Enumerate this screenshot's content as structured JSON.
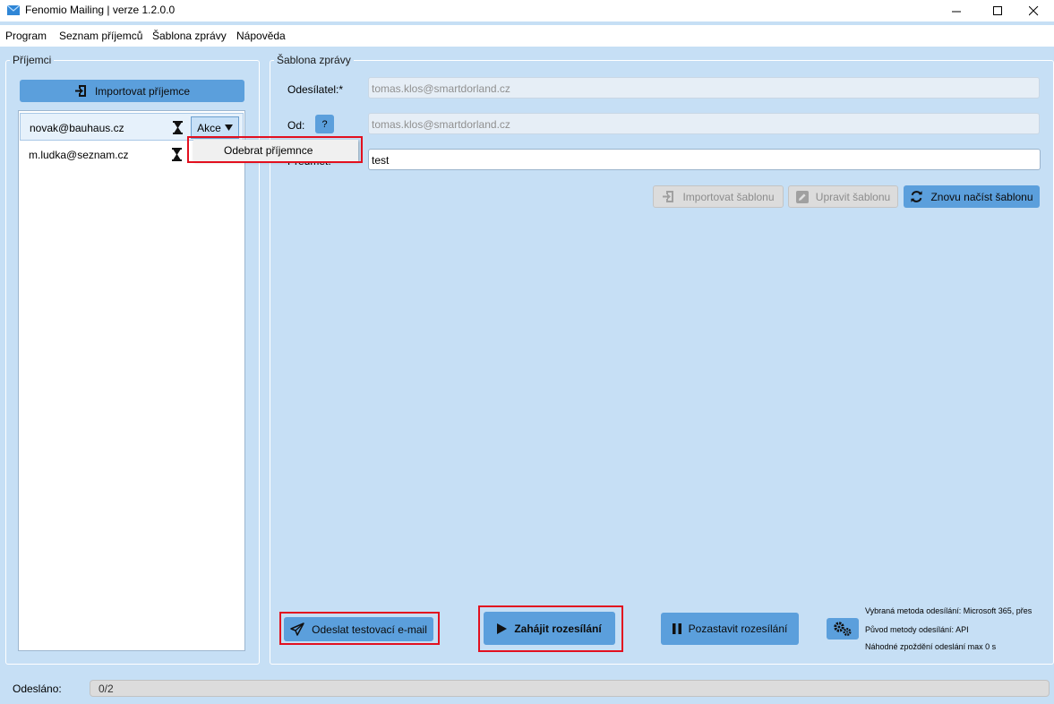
{
  "window": {
    "title": "Fenomio Mailing | verze 1.2.0.0"
  },
  "menu": {
    "items": [
      "Program",
      "Seznam příjemců",
      "Šablona zprávy",
      "Nápověda"
    ]
  },
  "recipients_panel": {
    "legend": "Příjemci",
    "import_button": "Importovat příjemce",
    "items": [
      {
        "email": "novak@bauhaus.cz",
        "action_label": "Akce",
        "selected": true
      },
      {
        "email": "m.ludka@seznam.cz",
        "selected": false
      }
    ],
    "context_menu": {
      "item": "Odebrat příjemnce"
    }
  },
  "template_panel": {
    "legend": "Šablona zprávy",
    "sender_label": "Odesílatel:*",
    "sender_value": "tomas.klos@smartdorland.cz",
    "from_label": "Od:",
    "help_label": "?",
    "from_value": "tomas.klos@smartdorland.cz",
    "subject_label": "Předmět:",
    "subject_value": "test",
    "import_template_button": "Importovat šablonu",
    "edit_template_button": "Upravit šablonu",
    "reload_template_button": "Znovu načíst šablonu",
    "send_test_button": "Odeslat testovací e-mail",
    "start_button": "Zahájit rozesílání",
    "pause_button": "Pozastavit rozesílání",
    "info": {
      "method": "Vybraná metoda odesílání: Microsoft 365, přes",
      "origin": "Původ metody odesílání: API",
      "delay": "Náhodné zpoždění odeslání max 0 s"
    }
  },
  "status": {
    "label": "Odesláno:",
    "progress_text": "0/2",
    "progress": 0
  },
  "colors": {
    "background": "#c6dff5",
    "button": "#5b9fdc",
    "highlight": "#e2101f"
  }
}
